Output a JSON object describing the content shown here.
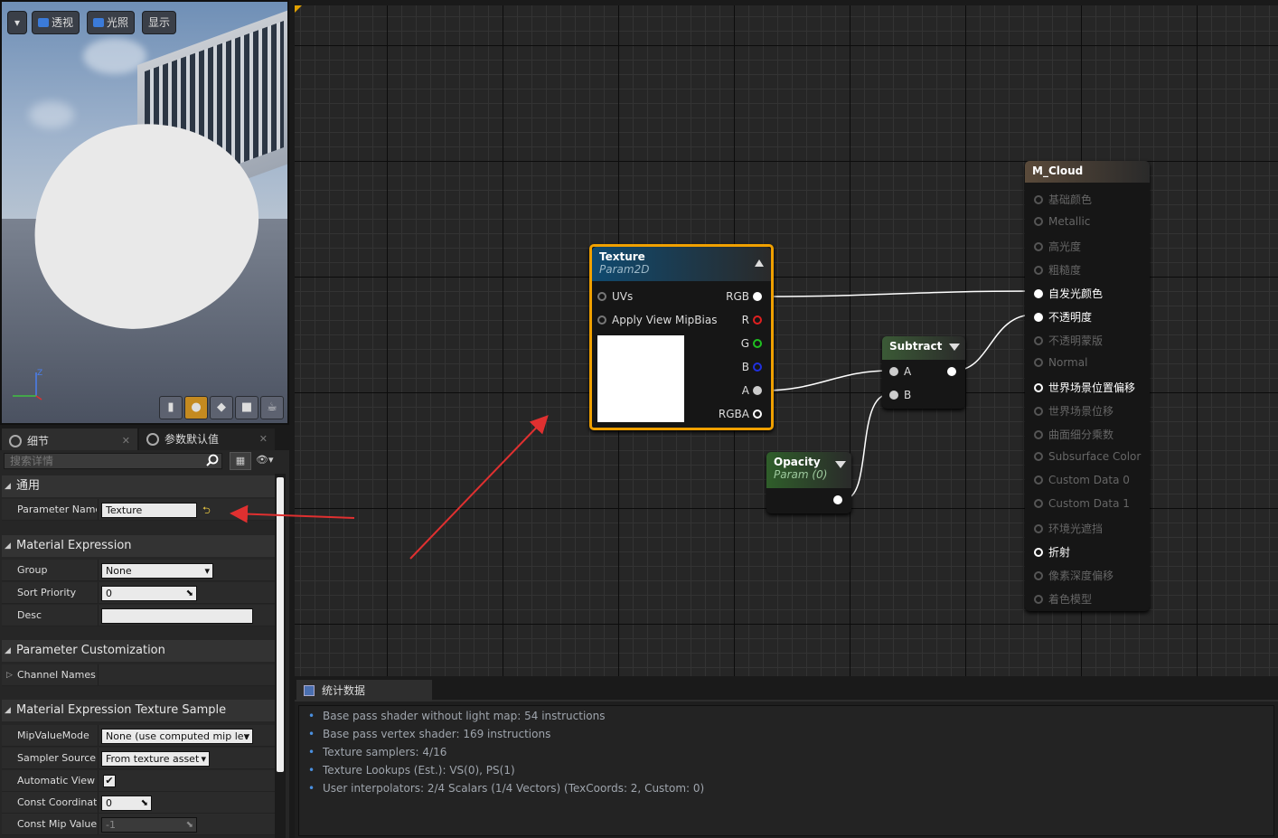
{
  "viewport": {
    "menu_icon": "chevron-down-icon",
    "perspective_label": "透视",
    "lit_label": "光照",
    "show_label": "显示",
    "axis_z": "Z",
    "preview_shapes": [
      "cylinder-icon",
      "sphere-icon",
      "plane-icon",
      "cube-icon",
      "teapot-icon"
    ]
  },
  "details": {
    "tab_details": "细节",
    "tab_params": "参数默认值",
    "search_placeholder": "搜索详情",
    "categories": {
      "general": "通用",
      "material_expression": "Material Expression",
      "param_customization": "Parameter Customization",
      "texture_sample": "Material Expression Texture Sample"
    },
    "rows": {
      "parameter_name": {
        "label": "Parameter Name",
        "value": "Texture"
      },
      "group": {
        "label": "Group",
        "value": "None"
      },
      "sort_priority": {
        "label": "Sort Priority",
        "value": "0"
      },
      "desc": {
        "label": "Desc",
        "value": ""
      },
      "channel_names": {
        "label": "Channel Names"
      },
      "mip_value_mode": {
        "label": "MipValueMode",
        "value": "None (use computed mip lev"
      },
      "sampler_source": {
        "label": "Sampler Source",
        "value": "From texture asset"
      },
      "automatic_view": {
        "label": "Automatic View M",
        "checked": true
      },
      "const_coordinate": {
        "label": "Const Coordinate",
        "value": "0"
      },
      "const_mip_value": {
        "label": "Const Mip Value",
        "value": "-1"
      }
    }
  },
  "graph": {
    "texture_node": {
      "title": "Texture",
      "subtitle": "Param2D",
      "inputs": [
        "UVs",
        "Apply View MipBias"
      ],
      "outputs": [
        "RGB",
        "R",
        "G",
        "B",
        "A",
        "RGBA"
      ]
    },
    "subtract_node": {
      "title": "Subtract",
      "inputs": [
        "A",
        "B"
      ]
    },
    "opacity_node": {
      "title": "Opacity",
      "subtitle": "Param (0)"
    },
    "material_node": {
      "title": "M_Cloud",
      "inputs": [
        {
          "label": "基础颜色",
          "active": false
        },
        {
          "label": "Metallic",
          "active": false
        },
        {
          "label": "高光度",
          "active": false
        },
        {
          "label": "粗糙度",
          "active": false
        },
        {
          "label": "自发光颜色",
          "active": true,
          "connected": true
        },
        {
          "label": "不透明度",
          "active": true,
          "connected": true
        },
        {
          "label": "不透明蒙版",
          "active": false
        },
        {
          "label": "Normal",
          "active": false
        },
        {
          "label": "世界场景位置偏移",
          "active": true,
          "connected": false
        },
        {
          "label": "世界场景位移",
          "active": false
        },
        {
          "label": "曲面细分乘数",
          "active": false
        },
        {
          "label": "Subsurface Color",
          "active": false
        },
        {
          "label": "Custom Data 0",
          "active": false
        },
        {
          "label": "Custom Data 1",
          "active": false
        },
        {
          "label": "环境光遮挡",
          "active": false
        },
        {
          "label": "折射",
          "active": true,
          "connected": false
        },
        {
          "label": "像素深度偏移",
          "active": false
        },
        {
          "label": "着色模型",
          "active": false
        }
      ]
    }
  },
  "stats": {
    "tab_label": "统计数据",
    "lines": [
      "Base pass shader without light map: 54 instructions",
      "Base pass vertex shader: 169 instructions",
      "Texture samplers: 4/16",
      "Texture Lookups (Est.): VS(0), PS(1)",
      "User interpolators: 2/4 Scalars (1/4 Vectors) (TexCoords: 2, Custom: 0)"
    ]
  },
  "colors": {
    "selected_node_border": "#f0a000",
    "annotation_arrow": "#e03030",
    "accent_blue": "#4a90e0"
  }
}
